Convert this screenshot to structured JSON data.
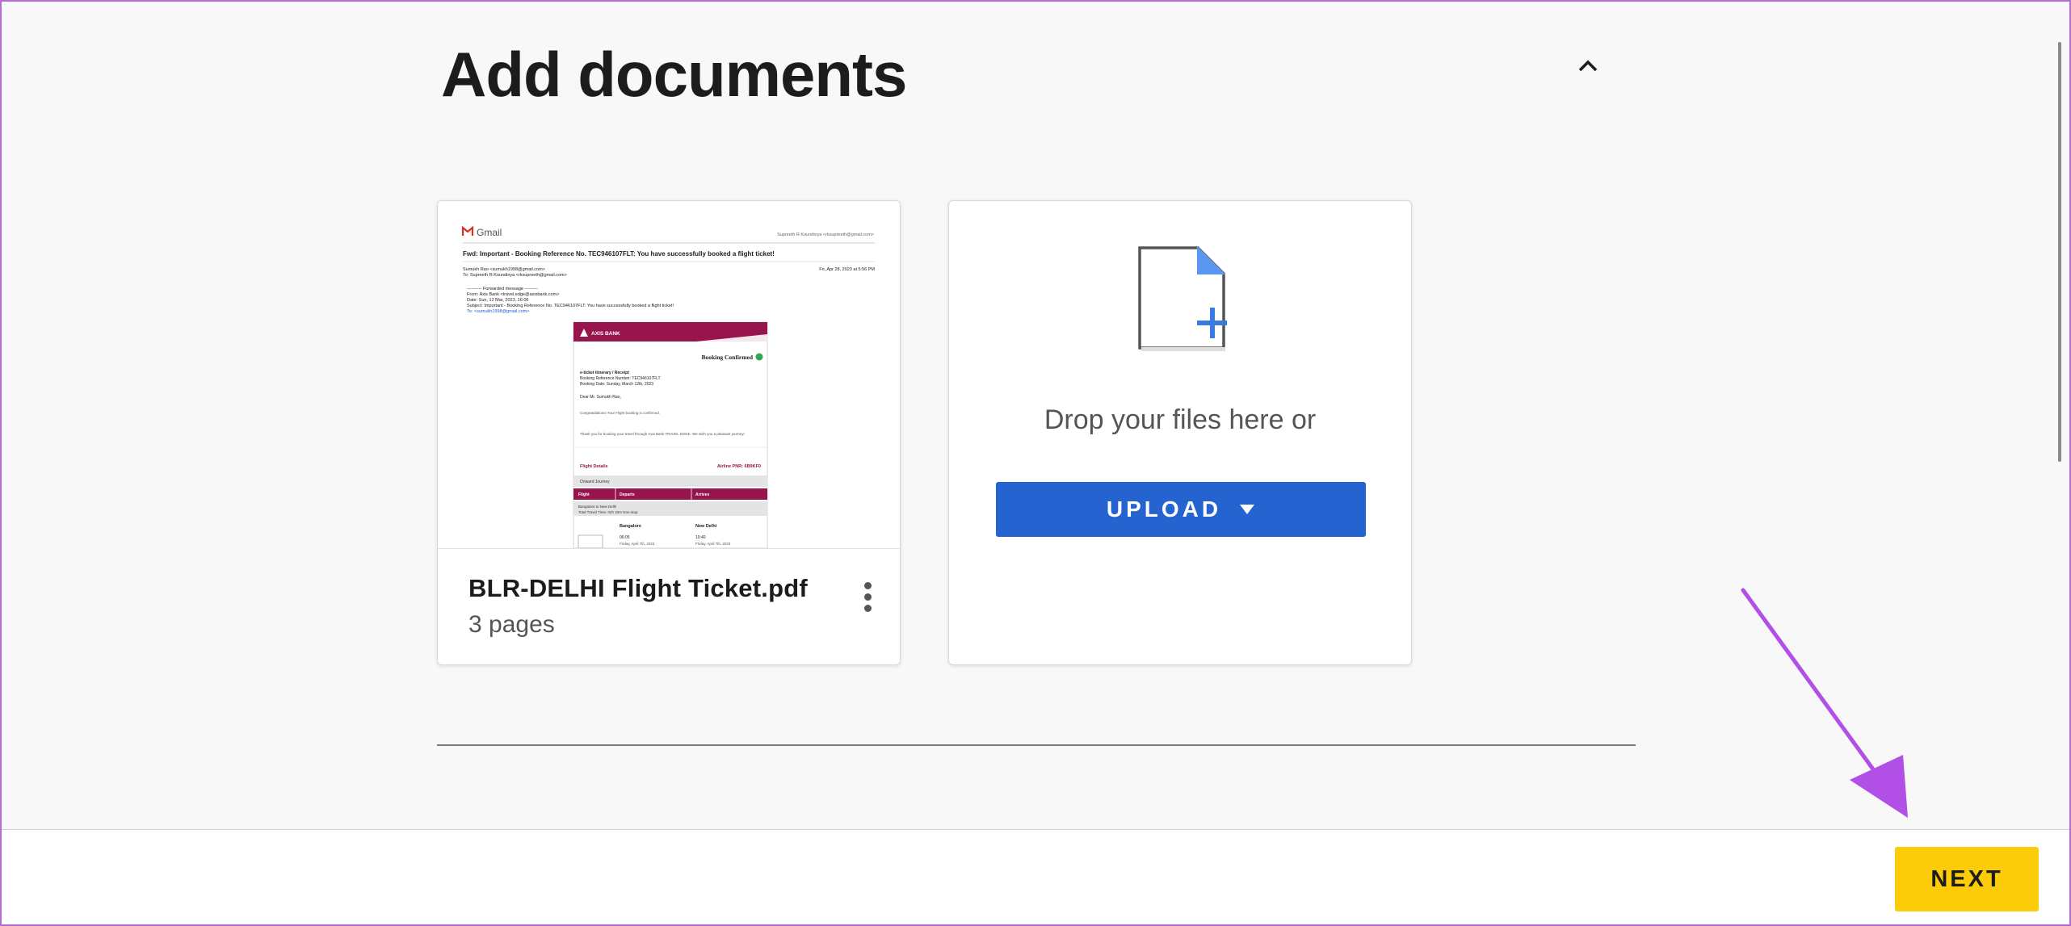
{
  "header": {
    "title": "Add documents"
  },
  "document": {
    "name": "BLR-DELHI Flight Ticket.pdf",
    "pages": "3 pages",
    "thumbnail": {
      "brand": "Gmail",
      "sender_top_right": "Supreeth R Koundinya <rksupreeth@gmail.com>",
      "subject": "Fwd: Important - Booking Reference No. TEC946107FLT: You have successfully booked a flight ticket!",
      "from_line": "Sumukh Rao <sumukh1998@gmail.com>",
      "date": "Fri, Apr 28, 2023 at 5:56 PM",
      "to_line": "To: Supreeth R Koundinya <rksupreeth@gmail.com>",
      "fwd_header": "---------- Forwarded message ---------",
      "fwd_from": "From: Axis Bank <travel.edge@axisbank.com>",
      "fwd_date": "Date: Sun, 12 Mar, 2023, 16:06",
      "fwd_subject": "Subject: Important - Booking Reference No. TEC946107FLT: You have successfully booked a flight ticket!",
      "fwd_to": "To: <sumukh1998@gmail.com>",
      "bank": "AXIS BANK",
      "status": "Booking Confirmed",
      "itinerary": "e-ticket itinerary / Receipt",
      "ref": "Booking Reference Number: TEC946107FLT",
      "booking_date": "Booking Date: Sunday, March 12th, 2023",
      "dear": "Dear Mr. Sumukh Rao,",
      "congrats": "Congratulations! Your Flight booking is confirmed.",
      "thanks": "Thank you for booking your travel through Axis Bank TRAVEL EDGE. We wish you a pleasant journey!",
      "flight_details": "Flight Details",
      "pnr": "Airline PNR: 6B9KF0",
      "journey": "Onward Journey",
      "col_flight": "Flight",
      "col_departs": "Departs",
      "col_arrives": "Arrives",
      "route": "Bangalore to New Delhi",
      "travel_time": "Total Travel Time: 02h 40m Non-stop",
      "dep_city": "Bangalore",
      "dep_time": "06:05",
      "dep_date": "Friday, April 7th, 2023",
      "arr_city": "New Delhi",
      "arr_time": "10:40",
      "arr_date": "Friday, April 7th, 2023"
    }
  },
  "upload": {
    "drop_text": "Drop your files here or",
    "button_label": "UPLOAD"
  },
  "footer": {
    "next_label": "NEXT"
  },
  "colors": {
    "upload_button": "#2563d0",
    "next_button": "#fccc0a",
    "annotation_arrow": "#b14fe6",
    "bank_maroon": "#97144d"
  }
}
